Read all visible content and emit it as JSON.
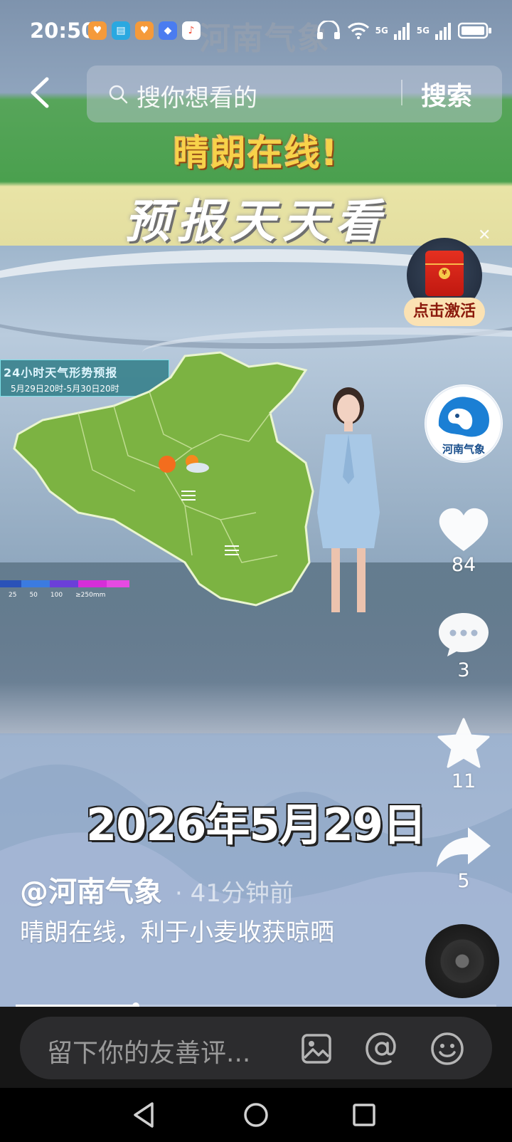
{
  "status_bar": {
    "time": "20:50",
    "network_1": "5G",
    "network_2": "5G"
  },
  "watermark": "河南气象",
  "search": {
    "placeholder": "搜你想看的",
    "button_label": "搜索"
  },
  "video": {
    "banner_top": "晴朗在线!",
    "banner_sub": "预报天天看",
    "forecast_title": "24小时天气形势预报",
    "forecast_range": "5月29日20时-5月30日20时",
    "legend_ticks": [
      "25",
      "50",
      "100",
      "≥250mm"
    ],
    "date_overlay": "2026年5月29日"
  },
  "promo": {
    "label": "点击激活",
    "coin": "¥"
  },
  "author": {
    "avatar_caption": "河南气象",
    "handle": "@河南气象",
    "post_time": "· 41分钟前"
  },
  "caption": "晴朗在线，利于小麦收获晾晒",
  "actions": {
    "likes": "84",
    "comments": "3",
    "favorites": "11",
    "shares": "5"
  },
  "playback": {
    "progress": 0.25
  },
  "comment_bar": {
    "placeholder": "留下你的友善评..."
  },
  "colors": {
    "accent_yellow": "#f7d24a",
    "comment_bg": "#161616",
    "input_bg": "#2c2c2e"
  }
}
